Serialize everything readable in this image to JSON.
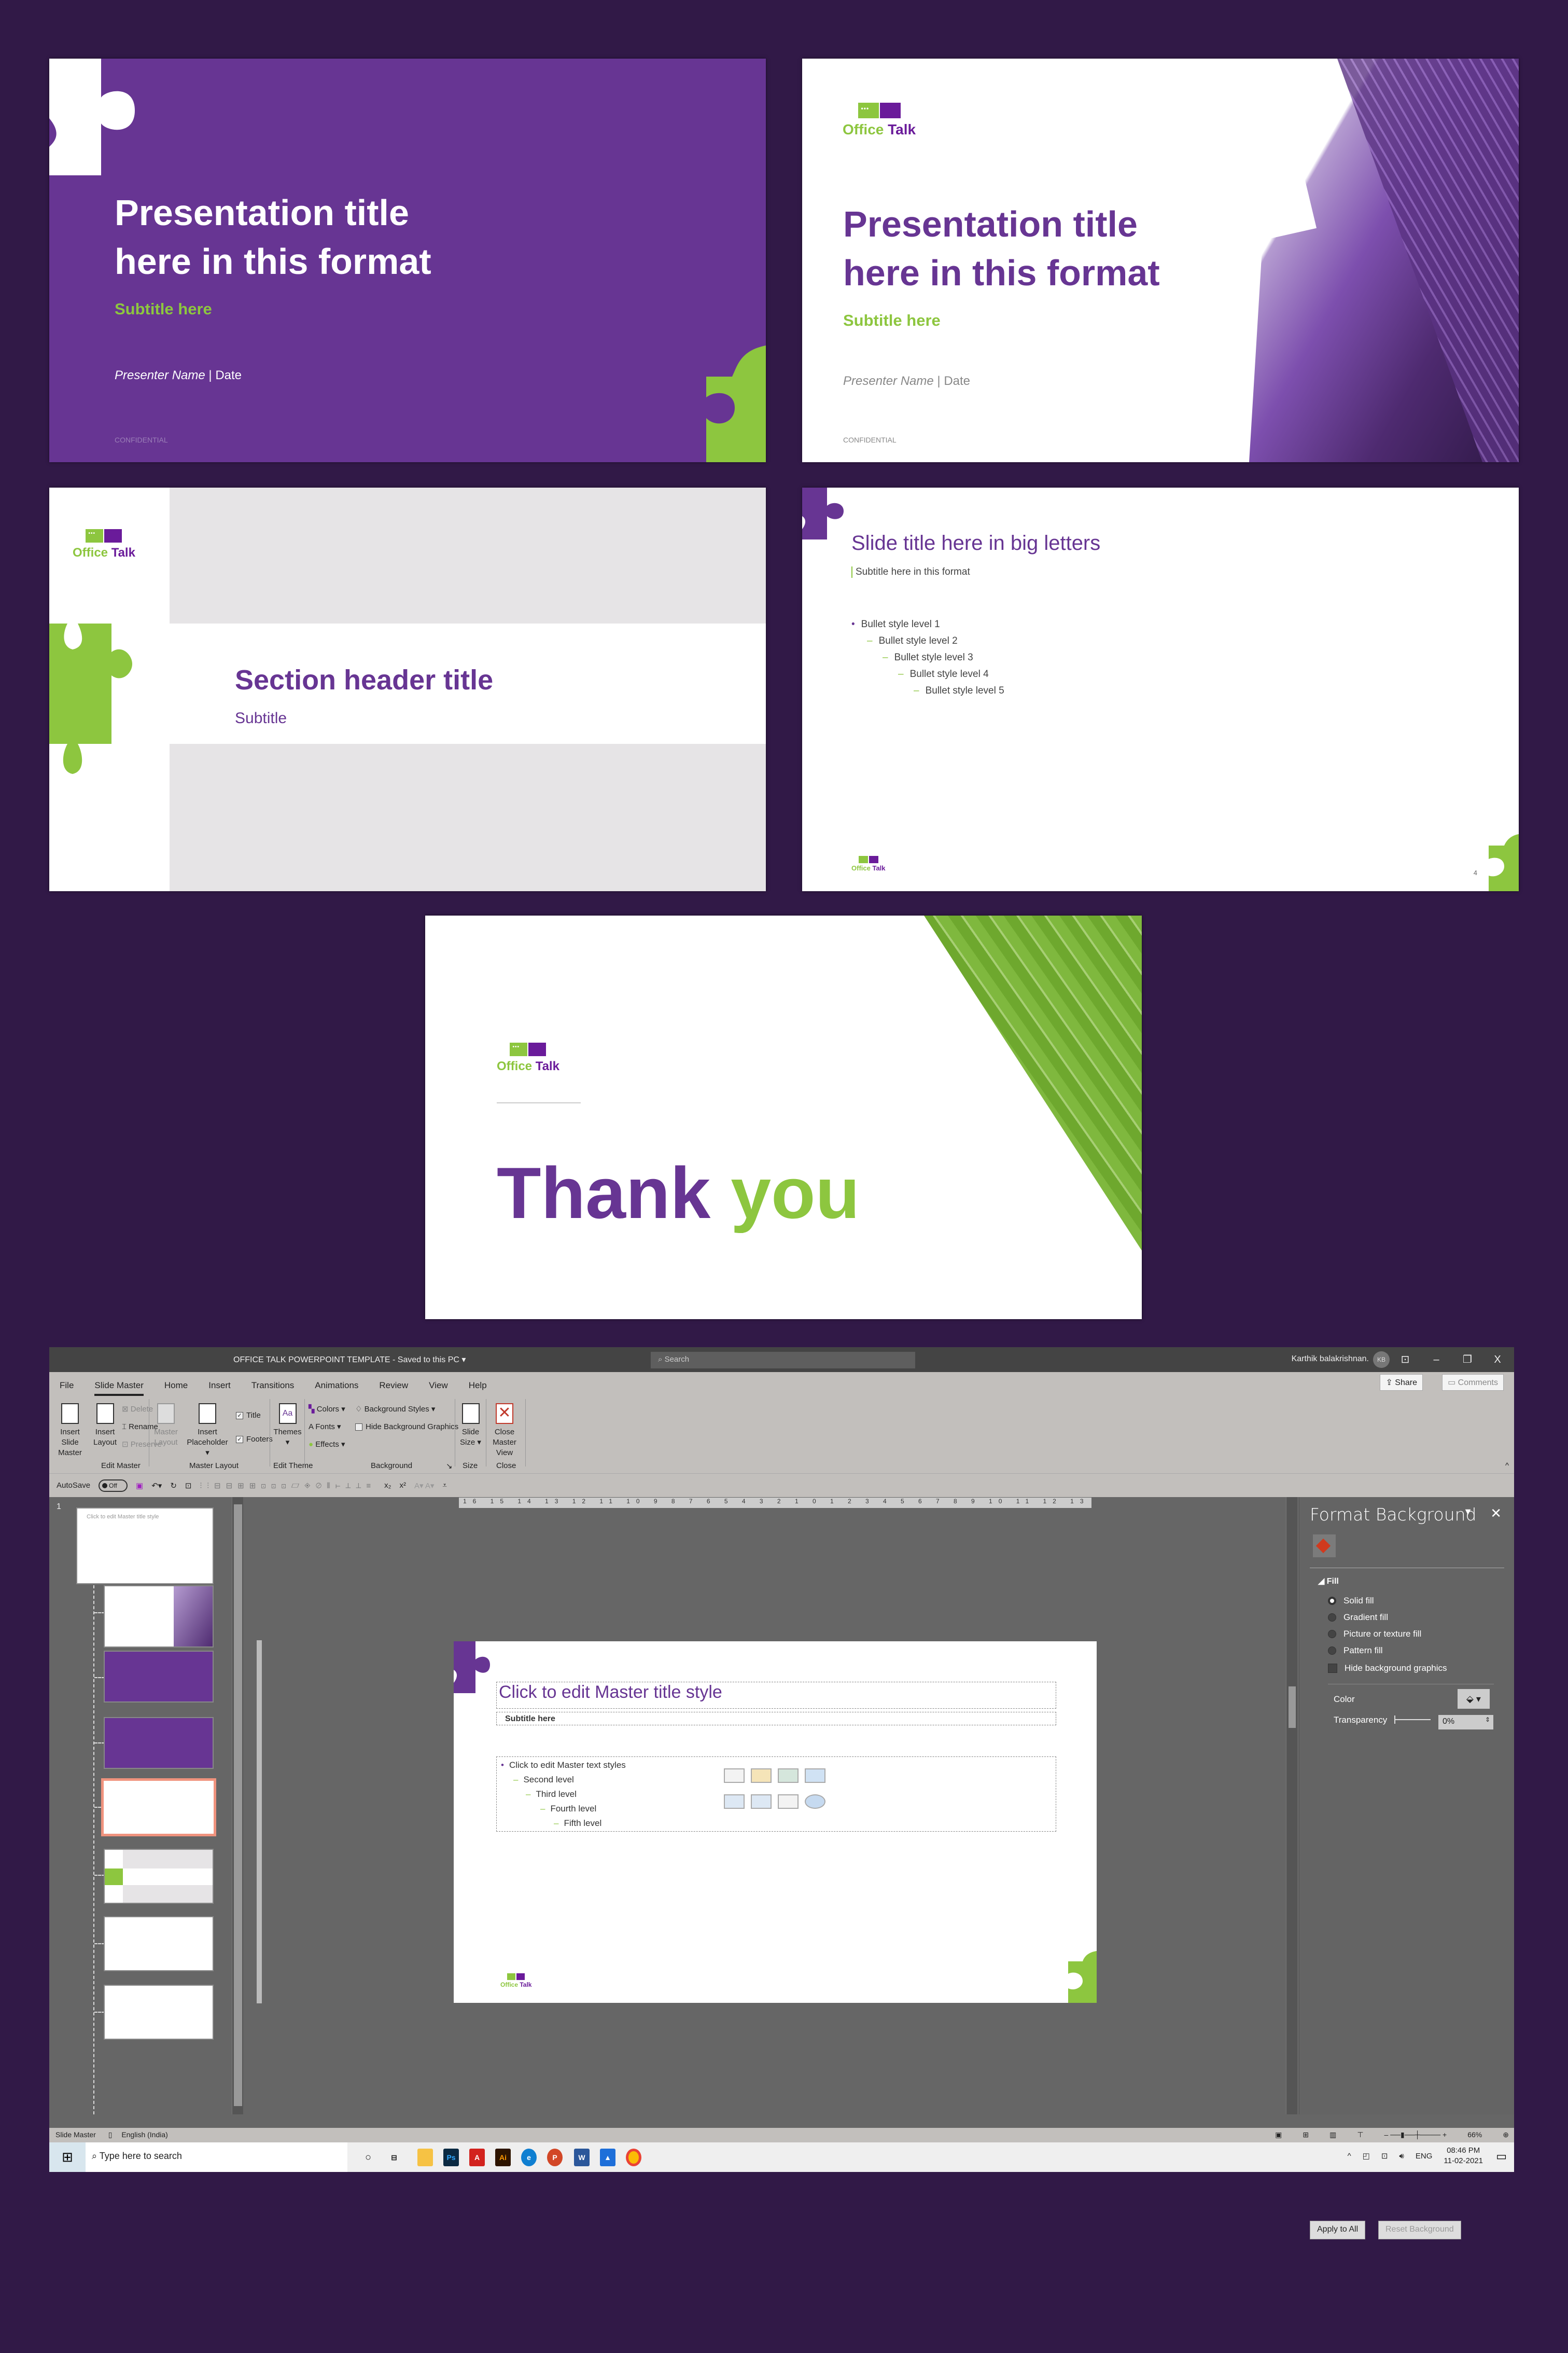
{
  "colors": {
    "purple": "#673593",
    "green": "#8dc63f",
    "bg": "#311947"
  },
  "logo": {
    "word1": "Office",
    "word2": "Talk",
    "dots": "•••"
  },
  "slide1": {
    "title_line1": "Presentation title",
    "title_line2": "here in this format",
    "subtitle": "Subtitle here",
    "presenter": "Presenter Name",
    "date": "Date",
    "confidential": "CONFIDENTIAL"
  },
  "slide2": {
    "title_line1": "Presentation title",
    "title_line2": "here in this format",
    "subtitle": "Subtitle here",
    "presenter": "Presenter Name",
    "date": "Date",
    "confidential": "CONFIDENTIAL"
  },
  "slide3": {
    "title": "Section header title",
    "subtitle": "Subtitle"
  },
  "slide4": {
    "title": "Slide title here in big letters",
    "subtitle": "Subtitle here in this format",
    "bullets": [
      "Bullet style level 1",
      "Bullet style level 2",
      "Bullet style level 3",
      "Bullet style level 4",
      "Bullet style level 5"
    ],
    "page_number": "4"
  },
  "slide5": {
    "thank": "Thank",
    "you": "you"
  },
  "app": {
    "document_title": "OFFICE TALK POWERPOINT TEMPLATE  -  Saved to this PC  ▾",
    "search_placeholder": "Search",
    "user_name": "Karthik balakrishnan.",
    "user_initials": "KB",
    "window_controls": {
      "ribbon_options": "⊡",
      "minimize": "–",
      "restore": "❐",
      "close": "X"
    },
    "tabs": [
      "File",
      "Slide Master",
      "Home",
      "Insert",
      "Transitions",
      "Animations",
      "Review",
      "View",
      "Help"
    ],
    "active_tab": "Slide Master",
    "share_label": "Share",
    "comments_label": "Comments",
    "ribbon": {
      "insert_slide_master": "Insert Slide Master",
      "insert_layout": "Insert Layout",
      "delete": "Delete",
      "rename": "Rename",
      "preserve": "Preserve",
      "master_layout": "Master Layout",
      "insert_placeholder": "Insert Placeholder ▾",
      "title_check": "Title",
      "footers_check": "Footers",
      "themes": "Themes ▾",
      "colors": "Colors ▾",
      "fonts": "Fonts ▾",
      "effects": "Effects ▾",
      "background_styles": "Background Styles ▾",
      "hide_bg_graphics": "Hide Background Graphics",
      "slide_size": "Slide Size ▾",
      "close_master_view": "Close Master View",
      "groups": {
        "edit_master": "Edit Master",
        "master_layout": "Master Layout",
        "edit_theme": "Edit Theme",
        "background": "Background",
        "size": "Size",
        "close": "Close"
      }
    },
    "autosave_label": "AutoSave",
    "autosave_state": "Off",
    "ruler_h": "16 15 14 13 12 11 10 9 8 7 6 5 4 3 2 1 0 1 2 3 4 5 6 7 8 9 10 11 12 13 14 15 16",
    "thumbnails": {
      "first_number": "1",
      "thumb_title": "Click to edit Master title style"
    },
    "canvas": {
      "title_placeholder": "Click to edit Master title style",
      "subtitle": "Subtitle here",
      "levels": [
        "Click to edit Master text styles",
        "Second level",
        "Third level",
        "Fourth level",
        "Fifth level"
      ]
    },
    "format_pane": {
      "title": "Format Background",
      "section": "Fill",
      "options": [
        {
          "label": "Solid fill",
          "selected": true
        },
        {
          "label": "Gradient fill",
          "selected": false
        },
        {
          "label": "Picture or texture fill",
          "selected": false
        },
        {
          "label": "Pattern fill",
          "selected": false
        }
      ],
      "hide_bg_graphics": "Hide background graphics",
      "color_label": "Color",
      "transparency_label": "Transparency",
      "transparency_value": "0%",
      "apply_all": "Apply to All",
      "reset_background": "Reset Background"
    },
    "status": {
      "view": "Slide Master",
      "language": "English (India)",
      "zoom": "66%"
    },
    "taskbar": {
      "search_placeholder": "Type here to search",
      "time": "08:46 PM",
      "date": "11-02-2021",
      "lang": "ENG",
      "apps": [
        "File Explorer",
        "Photoshop",
        "Acrobat",
        "Illustrator",
        "Edge",
        "PowerPoint",
        "Word",
        "Photos",
        "Chrome"
      ]
    }
  }
}
